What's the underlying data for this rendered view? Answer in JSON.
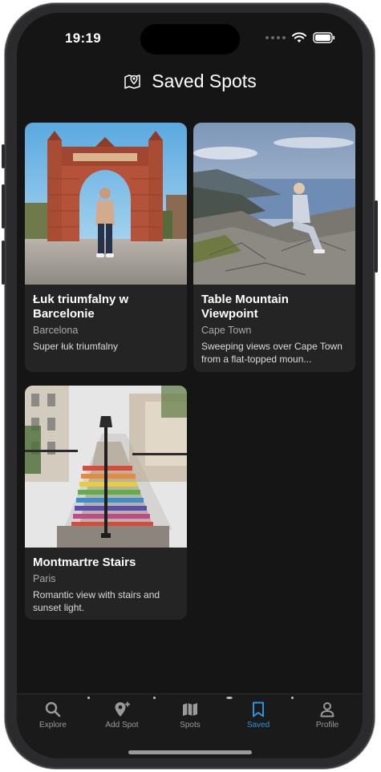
{
  "status_bar": {
    "time": "19:19"
  },
  "header": {
    "title": "Saved Spots",
    "icon": "map-pin-camera-icon"
  },
  "spots": [
    {
      "title": "Łuk triumfalny w Barcelonie",
      "city": "Barcelona",
      "description": "Super łuk triumfalny"
    },
    {
      "title": "Table Mountain Viewpoint",
      "city": "Cape Town",
      "description": "Sweeping views over Cape Town from a flat-topped moun..."
    },
    {
      "title": "Montmartre Stairs",
      "city": "Paris",
      "description": "Romantic view with stairs and sunset light."
    }
  ],
  "tabbar": {
    "items": [
      {
        "label": "Explore",
        "icon": "search-icon"
      },
      {
        "label": "Add Spot",
        "icon": "add-pin-icon"
      },
      {
        "label": "Spots",
        "icon": "map-icon"
      },
      {
        "label": "Saved",
        "icon": "bookmark-icon"
      },
      {
        "label": "Profile",
        "icon": "person-icon"
      }
    ],
    "active": "Saved"
  },
  "colors": {
    "accent": "#2f93d8",
    "background": "#151515",
    "card": "#242424"
  }
}
